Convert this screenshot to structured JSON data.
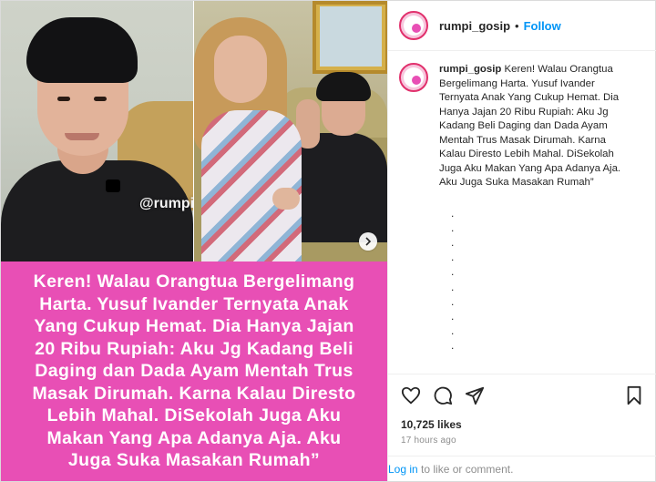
{
  "colors": {
    "brand_pink": "#e84fb5",
    "link_blue": "#0095f6",
    "muted_gray": "#8e8e8e",
    "text_dark": "#262626"
  },
  "media": {
    "watermark": "@rumpi_",
    "caption_lines": [
      "Keren! Walau Orangtua Bergelimang",
      "Harta. Yusuf Ivander Ternyata Anak",
      "Yang Cukup Hemat. Dia Hanya Jajan",
      "20 Ribu Rupiah: Aku Jg Kadang Beli",
      "Daging dan Dada Ayam Mentah Trus",
      "Masak Dirumah. Karna Kalau Diresto",
      "Lebih Mahal. DiSekolah Juga Aku",
      "Makan Yang Apa Adanya Aja. Aku",
      "Juga Suka Masakan Rumah”"
    ],
    "next_icon": "chevron-right-icon"
  },
  "header": {
    "username": "rumpi_gosip",
    "separator": "•",
    "follow_label": "Follow"
  },
  "post": {
    "username": "rumpi_gosip",
    "caption": "Keren! Walau Orangtua Bergelimang Harta. Yusuf Ivander Ternyata Anak Yang Cukup Hemat. Dia Hanya Jajan 20 Ribu Rupiah: Aku Jg Kadang Beli Daging dan Dada Ayam Mentah Trus Masak Dirumah. Karna Kalau Diresto Lebih Mahal. DiSekolah Juga Aku Makan Yang Apa Adanya Aja. Aku Juga Suka Masakan Rumah”",
    "dots": [
      ".",
      ".",
      ".",
      ".",
      ".",
      ".",
      ".",
      ".",
      ".",
      "."
    ]
  },
  "actions": {
    "icons": [
      "heart-icon",
      "comment-icon",
      "share-icon",
      "bookmark-icon"
    ]
  },
  "likes_text": "10,725 likes",
  "time_text": "17 hours ago",
  "login": {
    "link_label": "Log in",
    "rest_text": " to like or comment."
  }
}
